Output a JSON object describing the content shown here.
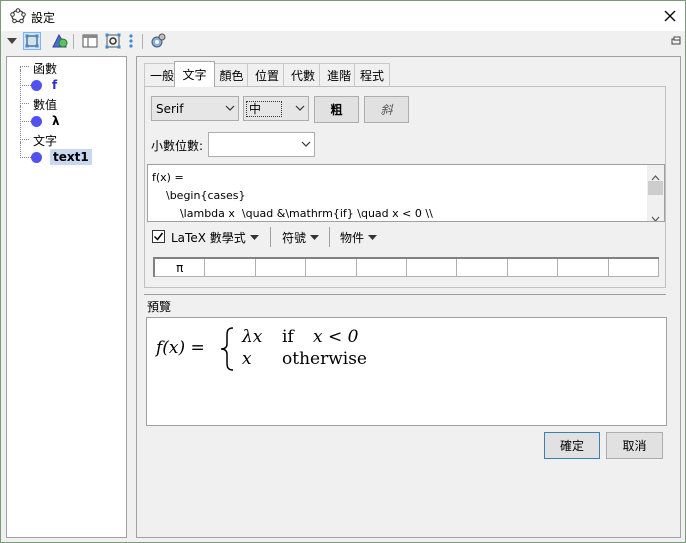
{
  "window": {
    "title": "設定"
  },
  "toolbar": {
    "icons": [
      "triangle-down-icon",
      "graphics-view-icon",
      "algebra-view-icon",
      "layout-icon",
      "settings-grid-icon",
      "more-vertical-icon",
      "gear-icon"
    ],
    "dock_icon": "undock-icon"
  },
  "tree": {
    "groups": [
      {
        "label": "函數",
        "items": [
          {
            "label": "f"
          }
        ]
      },
      {
        "label": "數值",
        "items": [
          {
            "label": "λ"
          }
        ]
      },
      {
        "label": "文字",
        "items": [
          {
            "label": "text1",
            "selected": true
          }
        ]
      }
    ]
  },
  "tabs": [
    "一般",
    "文字",
    "顏色",
    "位置",
    "代數",
    "進階",
    "程式"
  ],
  "active_tab": "文字",
  "text_tab": {
    "font_family": "Serif",
    "font_size": "中",
    "bold_label": "粗",
    "italic_label": "斜",
    "decimal_label": "小數位數:",
    "decimal_value": "",
    "editor_lines": [
      "f(x) =",
      "    \\begin{cases}",
      "        \\lambda x  \\quad &\\mathrm{if} \\quad x < 0 \\\\"
    ],
    "latex_label": "LaTeX 數學式",
    "latex_checked": true,
    "symbols_label": "符號",
    "objects_label": "物件",
    "symbol_cells": [
      "π",
      "",
      "",
      "",
      "",
      "",
      "",
      "",
      "",
      ""
    ]
  },
  "preview": {
    "label": "預覽",
    "lhs": "f(x) =",
    "row1_expr": "λx",
    "row1_cond": "if",
    "row1_rel": "x < 0",
    "row2_expr": "x",
    "row2_cond": "otherwise"
  },
  "footer": {
    "ok_label": "確定",
    "cancel_label": "取消"
  },
  "colors": {
    "object_dot": "#5151f0",
    "selection": "#c8d8f0"
  }
}
